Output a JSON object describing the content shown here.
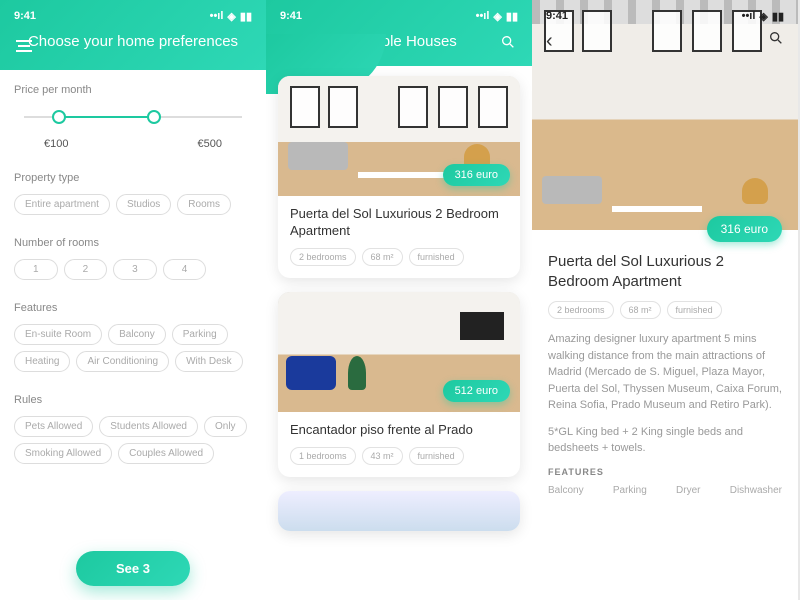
{
  "status": {
    "time": "9:41"
  },
  "screen1": {
    "title": "Choose your home preferences",
    "price_label": "Price per month",
    "price_min": "€100",
    "price_max": "€500",
    "ptype_label": "Property type",
    "ptype_options": [
      "Entire apartment",
      "Studios",
      "Rooms"
    ],
    "rooms_label": "Number of rooms",
    "rooms_options": [
      "1",
      "2",
      "3",
      "4"
    ],
    "features_label": "Features",
    "features_options": [
      "En-suite Room",
      "Balcony",
      "Parking",
      "Heating",
      "Air Conditioning",
      "With Desk"
    ],
    "rules_label": "Rules",
    "rules_options": [
      "Pets Allowed",
      "Students Allowed",
      "Only",
      "Smoking Allowed",
      "Couples Allowed"
    ],
    "cta": "See 3"
  },
  "screen2": {
    "title": "Available Houses",
    "listings": [
      {
        "price": "316 euro",
        "title": "Puerta del Sol Luxurious 2 Bedroom Apartment",
        "tags": [
          "2 bedrooms",
          "68 m²",
          "furnished"
        ]
      },
      {
        "price": "512 euro",
        "title": "Encantador piso frente al Prado",
        "tags": [
          "1 bedrooms",
          "43 m²",
          "furnished"
        ]
      }
    ]
  },
  "screen3": {
    "price": "316 euro",
    "title": "Puerta del Sol Luxurious 2 Bedroom Apartment",
    "tags": [
      "2 bedrooms",
      "68 m²",
      "furnished"
    ],
    "desc1": "Amazing designer luxury apartment 5 mins walking distance from the main attractions of Madrid (Mercado de S. Miguel, Plaza Mayor, Puerta del Sol, Thyssen Museum, Caixa Forum, Reina Sofia, Prado Museum and Retiro Park).",
    "desc2": "5*GL King bed + 2 King single beds and bedsheets + towels.",
    "features_label": "FEATURES",
    "features": [
      "Balcony",
      "Parking",
      "Dryer",
      "Dishwasher"
    ]
  }
}
